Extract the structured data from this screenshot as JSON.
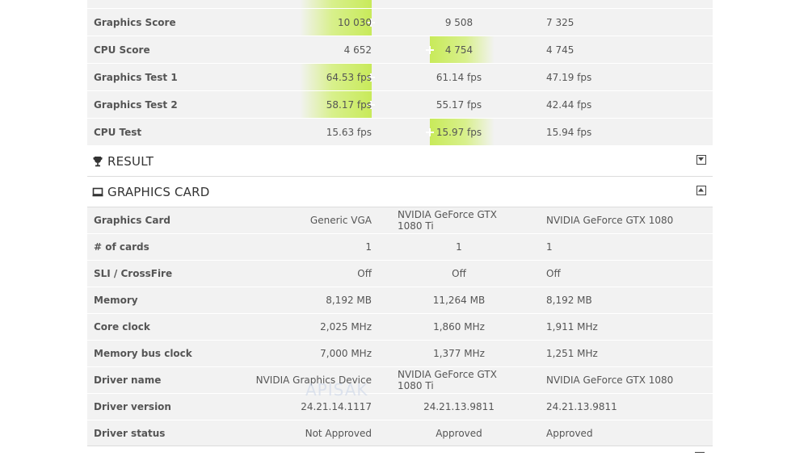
{
  "scores": {
    "rows": [
      {
        "label": "Graphics Score",
        "c1": "10 030",
        "c2": "9 508",
        "c3": "7 325",
        "best": 1
      },
      {
        "label": "CPU Score",
        "c1": "4 652",
        "c2": "4 754",
        "c3": "4 745",
        "best": 2
      },
      {
        "label": "Graphics Test 1",
        "c1": "64.53 fps",
        "c2": "61.14 fps",
        "c3": "47.19 fps",
        "best": 1
      },
      {
        "label": "Graphics Test 2",
        "c1": "58.17 fps",
        "c2": "55.17 fps",
        "c3": "42.44 fps",
        "best": 1
      },
      {
        "label": "CPU Test",
        "c1": "15.63 fps",
        "c2": "15.97 fps",
        "c3": "15.94 fps",
        "best": 2
      }
    ]
  },
  "result_section": {
    "title": "RESULT",
    "icon": "trophy-icon",
    "state": "collapsed"
  },
  "graphics_section": {
    "title": "GRAPHICS CARD",
    "icon": "monitor-icon",
    "state": "expanded"
  },
  "graphics": {
    "rows": [
      {
        "label": "Graphics Card",
        "c1": "Generic VGA",
        "c2": "NVIDIA GeForce GTX 1080 Ti",
        "c3": "NVIDIA GeForce GTX 1080"
      },
      {
        "label": "# of cards",
        "c1": "1",
        "c2": "1",
        "c3": "1"
      },
      {
        "label": "SLI / CrossFire",
        "c1": "Off",
        "c2": "Off",
        "c3": "Off"
      },
      {
        "label": "Memory",
        "c1": "8,192 MB",
        "c2": "11,264 MB",
        "c3": "8,192 MB"
      },
      {
        "label": "Core clock",
        "c1": "2,025 MHz",
        "c2": "1,860 MHz",
        "c3": "1,911 MHz"
      },
      {
        "label": "Memory bus clock",
        "c1": "7,000 MHz",
        "c2": "1,377 MHz",
        "c3": "1,251 MHz"
      },
      {
        "label": "Driver name",
        "c1": "NVIDIA Graphics Device",
        "c2": "NVIDIA GeForce GTX 1080 Ti",
        "c3": "NVIDIA GeForce GTX 1080"
      },
      {
        "label": "Driver version",
        "c1": "24.21.14.1117",
        "c2": "24.21.13.9811",
        "c3": "24.21.13.9811"
      },
      {
        "label": "Driver status",
        "c1": "Not Approved",
        "c2": "Approved",
        "c3": "Approved"
      }
    ]
  },
  "watermark": "APISAK",
  "colors": {
    "highlight": "#c8ea5a",
    "row_bg": "#f2f2f2"
  }
}
